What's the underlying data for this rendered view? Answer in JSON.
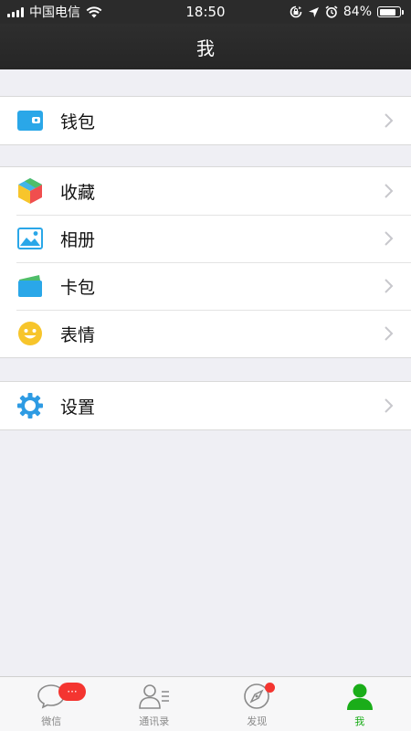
{
  "status_bar": {
    "carrier": "中国电信",
    "time": "18:50",
    "battery": "84%",
    "battery_level": 0.84,
    "icons": [
      "signal-icon",
      "wifi-icon",
      "rotation-lock-icon",
      "location-icon",
      "alarm-icon",
      "battery-icon"
    ]
  },
  "nav": {
    "title": "我"
  },
  "groups": [
    {
      "items": [
        {
          "label": "钱包",
          "icon": "wallet-icon"
        }
      ]
    },
    {
      "items": [
        {
          "label": "收藏",
          "icon": "favorites-cube-icon"
        },
        {
          "label": "相册",
          "icon": "album-picture-icon"
        },
        {
          "label": "卡包",
          "icon": "card-pack-icon"
        },
        {
          "label": "表情",
          "icon": "smiley-icon"
        }
      ]
    },
    {
      "items": [
        {
          "label": "设置",
          "icon": "gear-icon"
        }
      ]
    }
  ],
  "tabs": [
    {
      "label": "微信",
      "icon": "chat-bubble-icon",
      "badge": "···"
    },
    {
      "label": "通讯录",
      "icon": "contacts-icon"
    },
    {
      "label": "发现",
      "icon": "compass-icon",
      "dot": true
    },
    {
      "label": "我",
      "icon": "person-icon",
      "active": true
    }
  ],
  "colors": {
    "accent_green": "#1aad19",
    "badge_red": "#f43530",
    "nav_bg": "#2b2b2b",
    "page_bg": "#efeff4",
    "wallet_blue": "#2aa7e8",
    "gear_blue": "#2e9be3",
    "smiley_yellow": "#f7c52b"
  }
}
